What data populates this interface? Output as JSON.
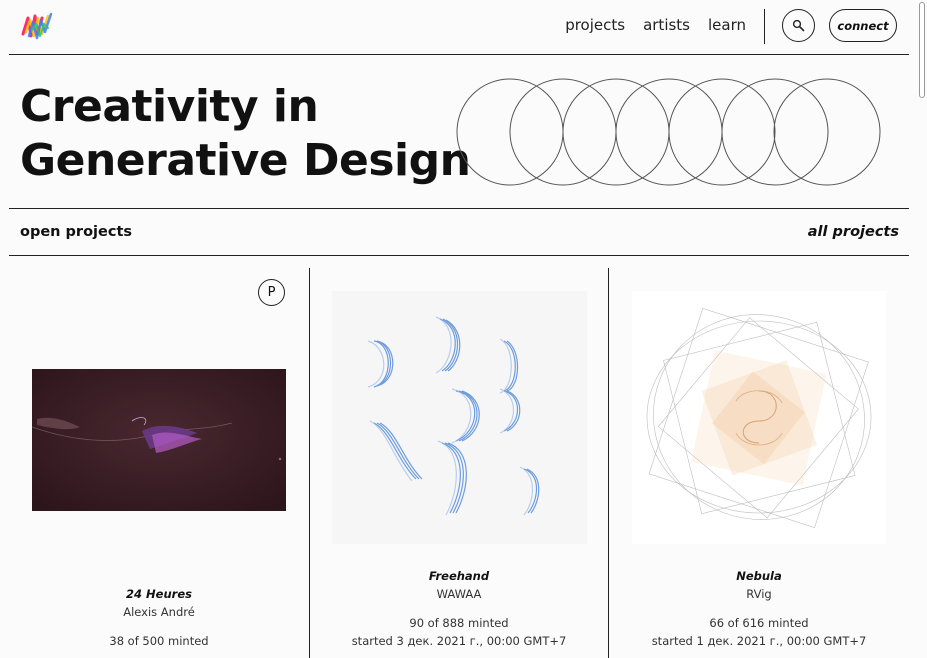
{
  "header": {
    "logo": "fxhash-logo-icon",
    "nav": [
      "projects",
      "artists",
      "learn"
    ],
    "search_icon": "search-icon",
    "connect_label": "connect"
  },
  "hero": {
    "title_line1": "Creativity in",
    "title_line2": "Generative Design"
  },
  "section": {
    "heading": "open projects",
    "all_link": "all projects"
  },
  "cards": [
    {
      "badge": "P",
      "title": "24 Heures",
      "artist": "Alexis André",
      "minted": "38 of 500 minted",
      "started": ""
    },
    {
      "title": "Freehand",
      "artist": "WAWAA",
      "minted": "90 of 888 minted",
      "started": "started 3 дек. 2021 г., 00:00 GMT+7"
    },
    {
      "title": "Nebula",
      "artist": "RVig",
      "minted": "66 of 616 minted",
      "started": "started 1 дек. 2021 г., 00:00 GMT+7"
    }
  ]
}
